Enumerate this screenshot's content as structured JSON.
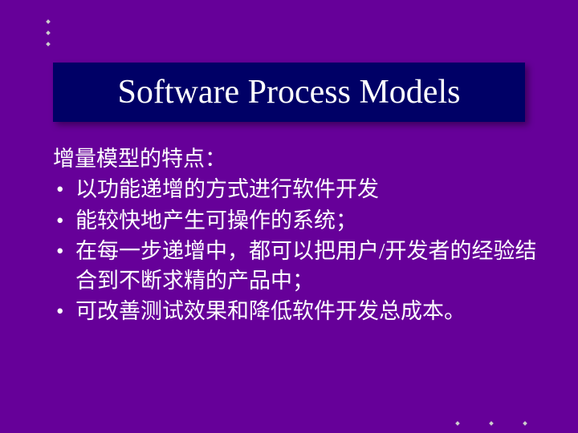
{
  "title": "Software Process Models",
  "heading": "增量模型的特点：",
  "bullets": [
    "以功能递增的方式进行软件开发",
    "能较快地产生可操作的系统；",
    "在每一步递增中，都可以把用户/开发者的经验结合到不断求精的产品中；",
    "可改善测试效果和降低软件开发总成本。"
  ]
}
